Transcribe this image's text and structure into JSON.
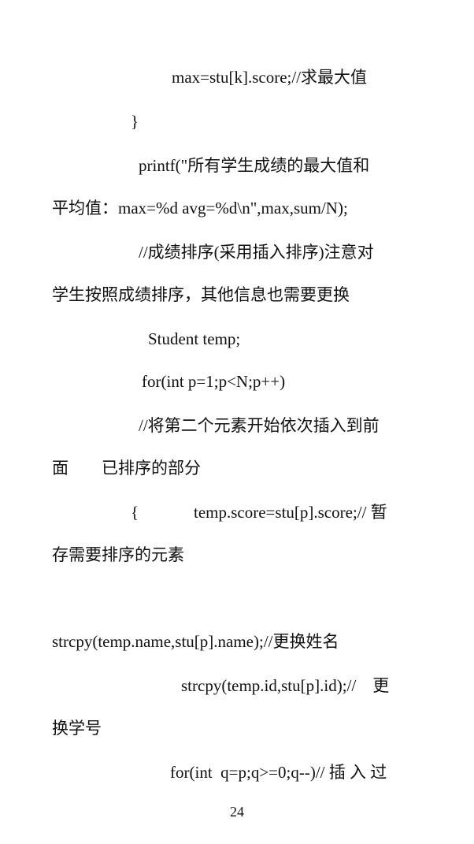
{
  "lines": [
    "max=stu[k].score;//求最大值",
    "}",
    "printf(\"所有学生成绩的最大值和",
    "平均值：max=%d avg=%d\\n\",max,sum/N);",
    "//成绩排序(采用插入排序)注意对",
    "学生按照成绩排序，其他信息也需要更换",
    "Student temp;",
    "for(int p=1;p<N;p++)",
    "//将第二个元素开始依次插入到前",
    "面　　已排序的部分",
    "{",
    "temp.score=stu[p].score;// 暂",
    "存需要排序的元素",
    "strcpy(temp.name,stu[p].name);//更换姓名",
    "strcpy(temp.id,stu[p].id);//　更",
    "换学号",
    "for(int  q=p;q>=0;q--)// 插 入 过"
  ],
  "page_number": "24"
}
